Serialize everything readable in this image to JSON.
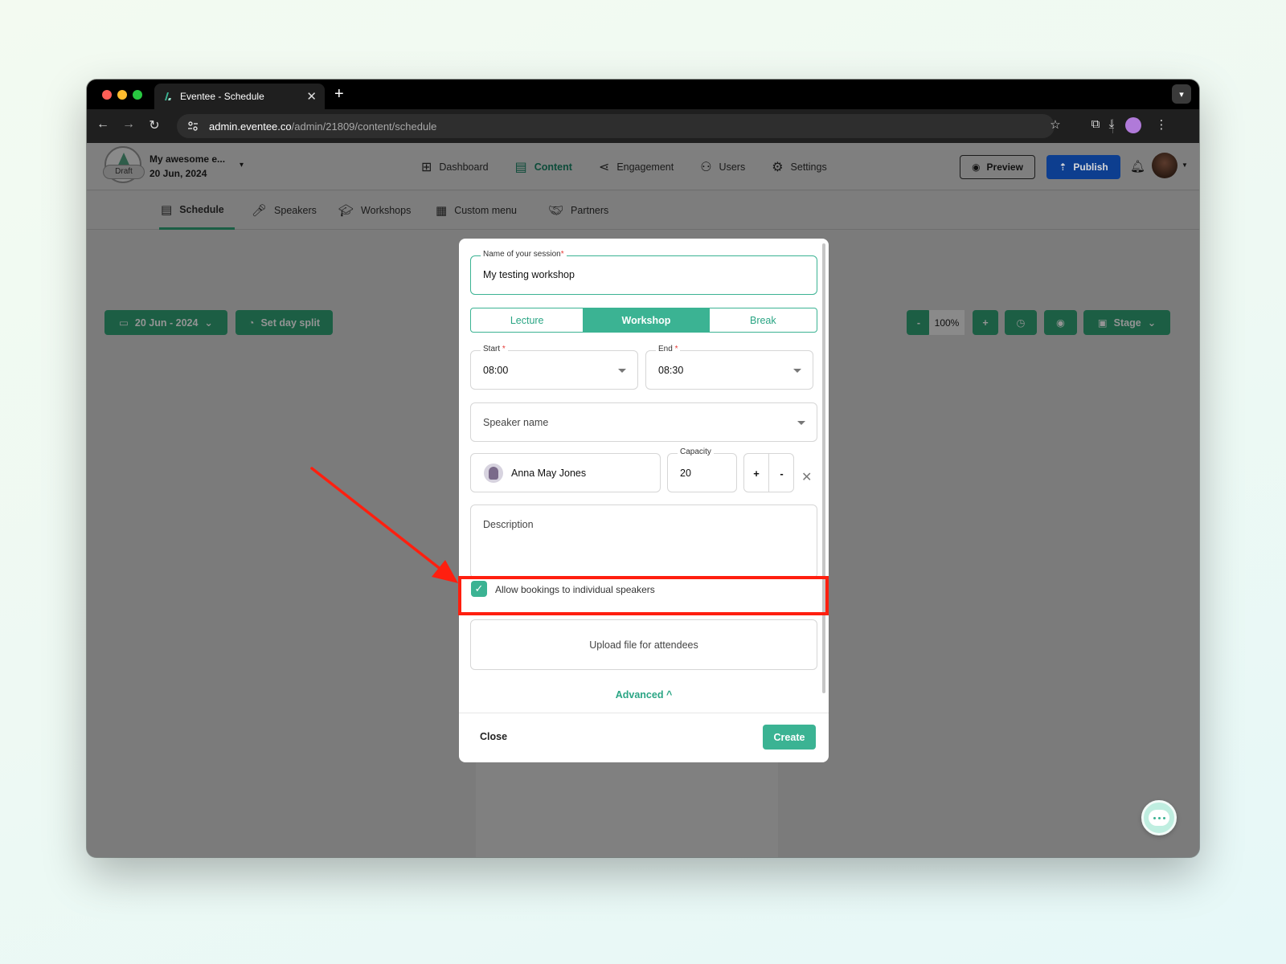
{
  "browser": {
    "tab_title": "Eventee - Schedule",
    "tab_close": "✕",
    "new_tab": "+",
    "url_host": "admin.eventee.co",
    "url_path": "/admin/21809/content/schedule"
  },
  "header": {
    "event_name": "My awesome e...",
    "event_date": "20 Jun, 2024",
    "draft_label": "Draft",
    "nav": [
      {
        "label": "Dashboard",
        "icon": "dashboard-icon"
      },
      {
        "label": "Content",
        "icon": "calendar-icon",
        "active": true
      },
      {
        "label": "Engagement",
        "icon": "share-icon"
      },
      {
        "label": "Users",
        "icon": "users-icon"
      },
      {
        "label": "Settings",
        "icon": "gear-icon"
      }
    ],
    "preview_label": "Preview",
    "publish_label": "Publish"
  },
  "subnav": [
    {
      "label": "Schedule",
      "icon": "calendar-icon",
      "active": true
    },
    {
      "label": "Speakers",
      "icon": "microphone-icon"
    },
    {
      "label": "Workshops",
      "icon": "graduation-cap-icon"
    },
    {
      "label": "Custom menu",
      "icon": "document-icon"
    },
    {
      "label": "Partners",
      "icon": "handshake-icon"
    }
  ],
  "toolbar": {
    "date_label": "20 Jun - 2024",
    "day_split_label": "Set day split",
    "zoom_out": "-",
    "zoom_value": "100%",
    "zoom_in": "+",
    "stage_label": "Stage"
  },
  "modal": {
    "name_label": "Name of your session",
    "required_mark": "*",
    "name_value": "My testing workshop",
    "types": [
      {
        "label": "Lecture"
      },
      {
        "label": "Workshop",
        "active": true
      },
      {
        "label": "Break"
      }
    ],
    "start_label": "Start",
    "start_value": "08:00",
    "end_label": "End",
    "end_value": "08:30",
    "speaker_placeholder": "Speaker name",
    "speaker_selected": "Anna May Jones",
    "capacity_label": "Capacity",
    "capacity_value": "20",
    "plus": "+",
    "minus": "-",
    "remove": "✕",
    "description_placeholder": "Description",
    "allow_bookings_label": "Allow bookings to individual speakers",
    "allow_bookings_checked": true,
    "upload_label": "Upload file for attendees",
    "advanced_label": "Advanced ^",
    "close_label": "Close",
    "create_label": "Create"
  },
  "colors": {
    "accent": "#3bb393",
    "annotation": "#ff1f0f",
    "publish": "#0d3e8f"
  }
}
